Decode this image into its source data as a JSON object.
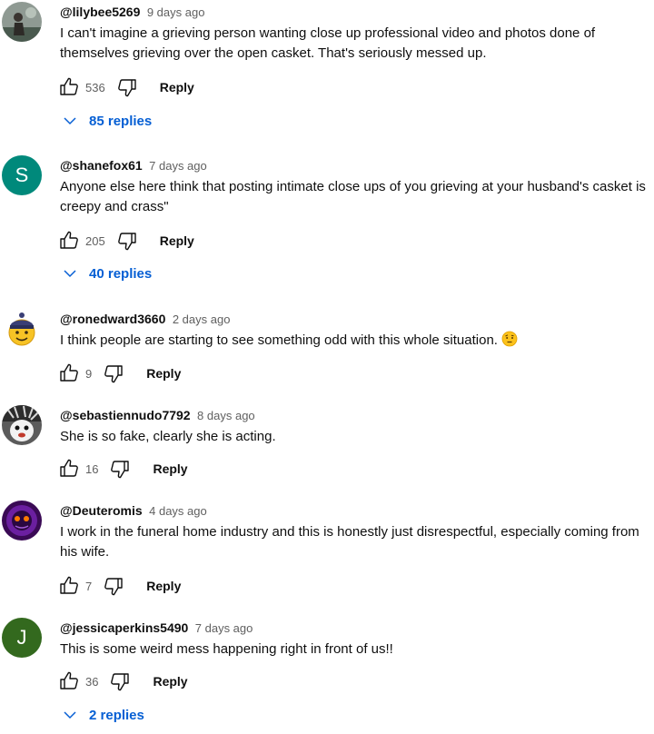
{
  "comments": [
    {
      "author": "@lilybee5269",
      "time": "9 days ago",
      "text": "I can't imagine a grieving person wanting close up professional video and photos done of themselves grieving over the open casket. That's seriously messed up.",
      "likes": "536",
      "reply_label": "Reply",
      "replies_label": "85 replies"
    },
    {
      "author": "@shanefox61",
      "avatar_letter": "S",
      "avatar_color": "#00897b",
      "time": "7 days ago",
      "text": "Anyone else here think that posting intimate close ups of you grieving at your husband's casket is creepy and crass\"",
      "likes": "205",
      "reply_label": "Reply",
      "replies_label": "40 replies"
    },
    {
      "author": "@ronedward3660",
      "time": "2 days ago",
      "text": "I think people are starting to see something odd with this whole situation.",
      "likes": "9",
      "reply_label": "Reply"
    },
    {
      "author": "@sebastiennudo7792",
      "time": "8 days ago",
      "text": "She is so fake, clearly she is acting.",
      "likes": "16",
      "reply_label": "Reply"
    },
    {
      "author": "@Deuteromis",
      "time": "4 days ago",
      "text": "I work in the funeral home industry and this is honestly just disrespectful, especially coming from his wife.",
      "likes": "7",
      "reply_label": "Reply"
    },
    {
      "author": "@jessicaperkins5490",
      "avatar_letter": "J",
      "avatar_color": "#33691e",
      "time": "7 days ago",
      "text": "This is some weird mess happening right in front of us!!",
      "likes": "36",
      "reply_label": "Reply",
      "replies_label": "2 replies"
    }
  ],
  "colors": {
    "link_blue": "#065fd4",
    "meta_gray": "#606060"
  }
}
